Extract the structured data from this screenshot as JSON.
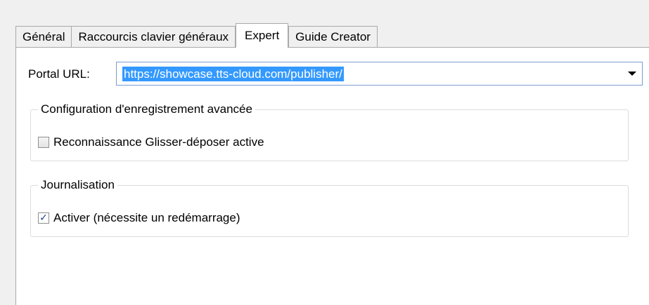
{
  "tabs": [
    {
      "label": "Général",
      "active": false
    },
    {
      "label": "Raccourcis clavier généraux",
      "active": false
    },
    {
      "label": "Expert",
      "active": true
    },
    {
      "label": "Guide Creator",
      "active": false
    }
  ],
  "portal": {
    "label": "Portal URL:",
    "value": "https://showcase.tts-cloud.com/publisher/"
  },
  "recording_group": {
    "title": "Configuration d'enregistrement avancée",
    "drag_drop": {
      "label": "Reconnaissance Glisser-déposer active",
      "checked": false
    }
  },
  "logging_group": {
    "title": "Journalisation",
    "enable": {
      "label": "Activer (nécessite un redémarrage)",
      "checked": true
    }
  },
  "icons": {
    "dropdown": "chevron-down-icon",
    "check": "checkmark-icon"
  },
  "colors": {
    "selection": "#3399ff",
    "checkmark": "#1f3f8f"
  }
}
